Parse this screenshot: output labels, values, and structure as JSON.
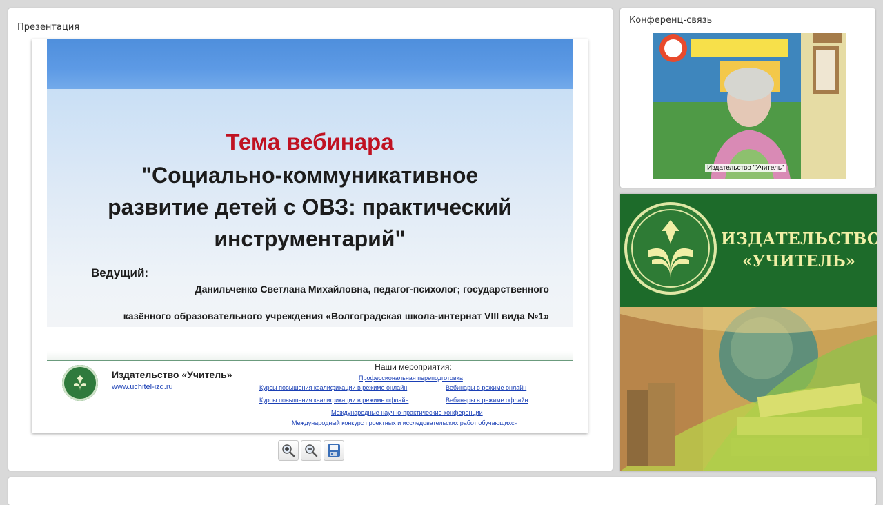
{
  "presentation": {
    "panel_title": "Презентация",
    "slide": {
      "theme_label": "Тема вебинара",
      "topic_line1": "\"Социально-коммуникативное",
      "topic_line2": "развитие детей с ОВЗ: практический",
      "topic_line3": "инструментарий\"",
      "presenter_label": "Ведущий:",
      "presenter_name": "Данильченко Светлана Михайловна, педагог-психолог; государственного",
      "presenter_org": "казённого образовательного  учреждения «Волгоградская школа-интернат VIII вида №1»",
      "footer": {
        "publisher_name": "Издательство «Учитель»",
        "publisher_url": "www.uchitel-izd.ru",
        "events_title": "Наши мероприятия:",
        "events": [
          "Профессиональная переподготовка",
          "Курсы повышения квалификации в режиме онлайн",
          "Вебинары в режиме онлайн",
          "Курсы повышения квалификации в режиме офлайн",
          "Вебинары в режиме офлайн",
          "Международные научно-практические конференции",
          "Международный конкурс проектных и исследовательских работ обучающихся"
        ]
      }
    },
    "toolbar": {
      "zoom_in_icon": "zoom-in-icon",
      "zoom_out_icon": "zoom-out-icon",
      "save_icon": "floppy-disk-icon"
    }
  },
  "conference": {
    "panel_title": "Конференц-связь",
    "video_label": "Издательство \"Учитель\""
  },
  "banner": {
    "line1": "ИЗДАТЕЛЬСТВО",
    "line2": "«УЧИТЕЛЬ»"
  },
  "colors": {
    "accent_red": "#c01222",
    "link_blue": "#1a3fb5",
    "banner_green": "#1d6b2a",
    "banner_text": "#f1efa6"
  }
}
